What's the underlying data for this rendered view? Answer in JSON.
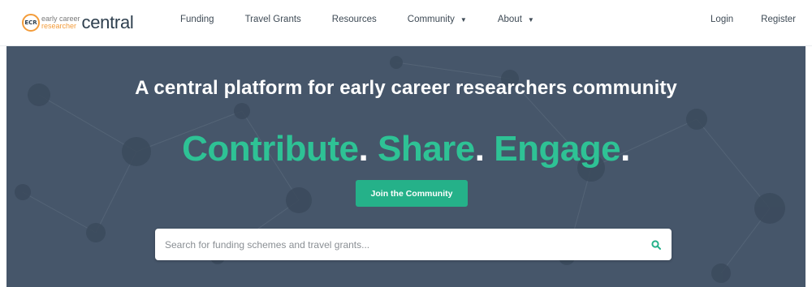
{
  "brand": {
    "badge": "ECR",
    "line1": "early career",
    "line2": "researcher",
    "name": "central"
  },
  "nav": {
    "items": [
      {
        "label": "Funding",
        "dropdown": false
      },
      {
        "label": "Travel Grants",
        "dropdown": false
      },
      {
        "label": "Resources",
        "dropdown": false
      },
      {
        "label": "Community",
        "dropdown": true
      },
      {
        "label": "About",
        "dropdown": true
      }
    ],
    "login_label": "Login",
    "register_label": "Register",
    "caret_icon": "chevron-down-icon"
  },
  "hero": {
    "headline": "A central platform for early career researchers community",
    "tagline_words": [
      "Contribute",
      "Share",
      "Engage"
    ],
    "tagline_separator": ".",
    "cta_label": "Join the Community",
    "search": {
      "placeholder": "Search for funding schemes and travel grants...",
      "value": "",
      "icon": "search-icon"
    }
  },
  "colors": {
    "accent": "#2ec295",
    "button": "#25b189",
    "hero_bg": "#46566a",
    "brand_orange": "#f39c3a",
    "text_dark": "#2e3f4e"
  }
}
